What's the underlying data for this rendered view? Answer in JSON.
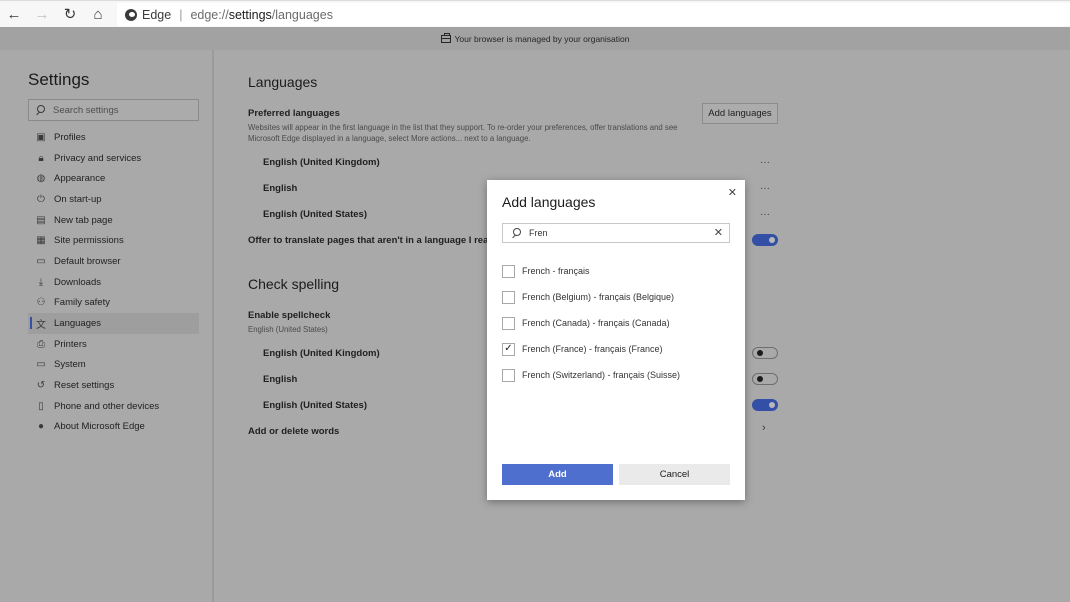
{
  "browser": {
    "back_icon": "←",
    "forward_icon": "→",
    "refresh_icon": "↻",
    "home_icon": "⌂",
    "site_label": "Edge",
    "url_prefix": "edge://",
    "url_bold": "settings",
    "url_suffix": "/languages"
  },
  "banner": {
    "text": "Your browser is managed by your organisation"
  },
  "sidebar": {
    "title": "Settings",
    "search_placeholder": "Search settings",
    "items": [
      {
        "label": "Profiles",
        "icon": "▣"
      },
      {
        "label": "Privacy and services",
        "icon": "🔒︎"
      },
      {
        "label": "Appearance",
        "icon": "◍"
      },
      {
        "label": "On start-up",
        "icon": "⏻"
      },
      {
        "label": "New tab page",
        "icon": "▤"
      },
      {
        "label": "Site permissions",
        "icon": "▦"
      },
      {
        "label": "Default browser",
        "icon": "▭"
      },
      {
        "label": "Downloads",
        "icon": "⤓"
      },
      {
        "label": "Family safety",
        "icon": "⚇"
      },
      {
        "label": "Languages",
        "icon": "文",
        "active": true
      },
      {
        "label": "Printers",
        "icon": "⎙"
      },
      {
        "label": "System",
        "icon": "▭"
      },
      {
        "label": "Reset settings",
        "icon": "↺"
      },
      {
        "label": "Phone and other devices",
        "icon": "▯"
      },
      {
        "label": "About Microsoft Edge",
        "icon": "●"
      }
    ]
  },
  "main": {
    "title": "Languages",
    "preferred": {
      "heading": "Preferred languages",
      "description": "Websites will appear in the first language in the list that they support. To re-order your preferences, offer translations and see Microsoft Edge displayed in a language, select More actions... next to a language.",
      "add_button": "Add languages",
      "languages": [
        "English (United Kingdom)",
        "English",
        "English (United States)"
      ],
      "more_label": "···"
    },
    "offer_translate": {
      "label": "Offer to translate pages that aren't in a language I read",
      "enabled": true
    },
    "spellcheck": {
      "heading": "Check spelling",
      "enable_label": "Enable spellcheck",
      "enable_sub": "English (United States)",
      "languages": [
        {
          "label": "English (United Kingdom)",
          "enabled": false
        },
        {
          "label": "English",
          "enabled": false
        },
        {
          "label": "English (United States)",
          "enabled": true
        }
      ],
      "add_delete_label": "Add or delete words",
      "chevron": "›"
    }
  },
  "dialog": {
    "title": "Add languages",
    "close_icon": "✕",
    "search_value": "Fren",
    "clear_icon": "✕",
    "options": [
      {
        "label": "French - français",
        "checked": false
      },
      {
        "label": "French (Belgium) - français (Belgique)",
        "checked": false
      },
      {
        "label": "French (Canada) - français (Canada)",
        "checked": false
      },
      {
        "label": "French (France) - français (France)",
        "checked": true
      },
      {
        "label": "French (Switzerland) - français (Suisse)",
        "checked": false
      }
    ],
    "add_button": "Add",
    "cancel_button": "Cancel",
    "check_glyph": "✓"
  }
}
